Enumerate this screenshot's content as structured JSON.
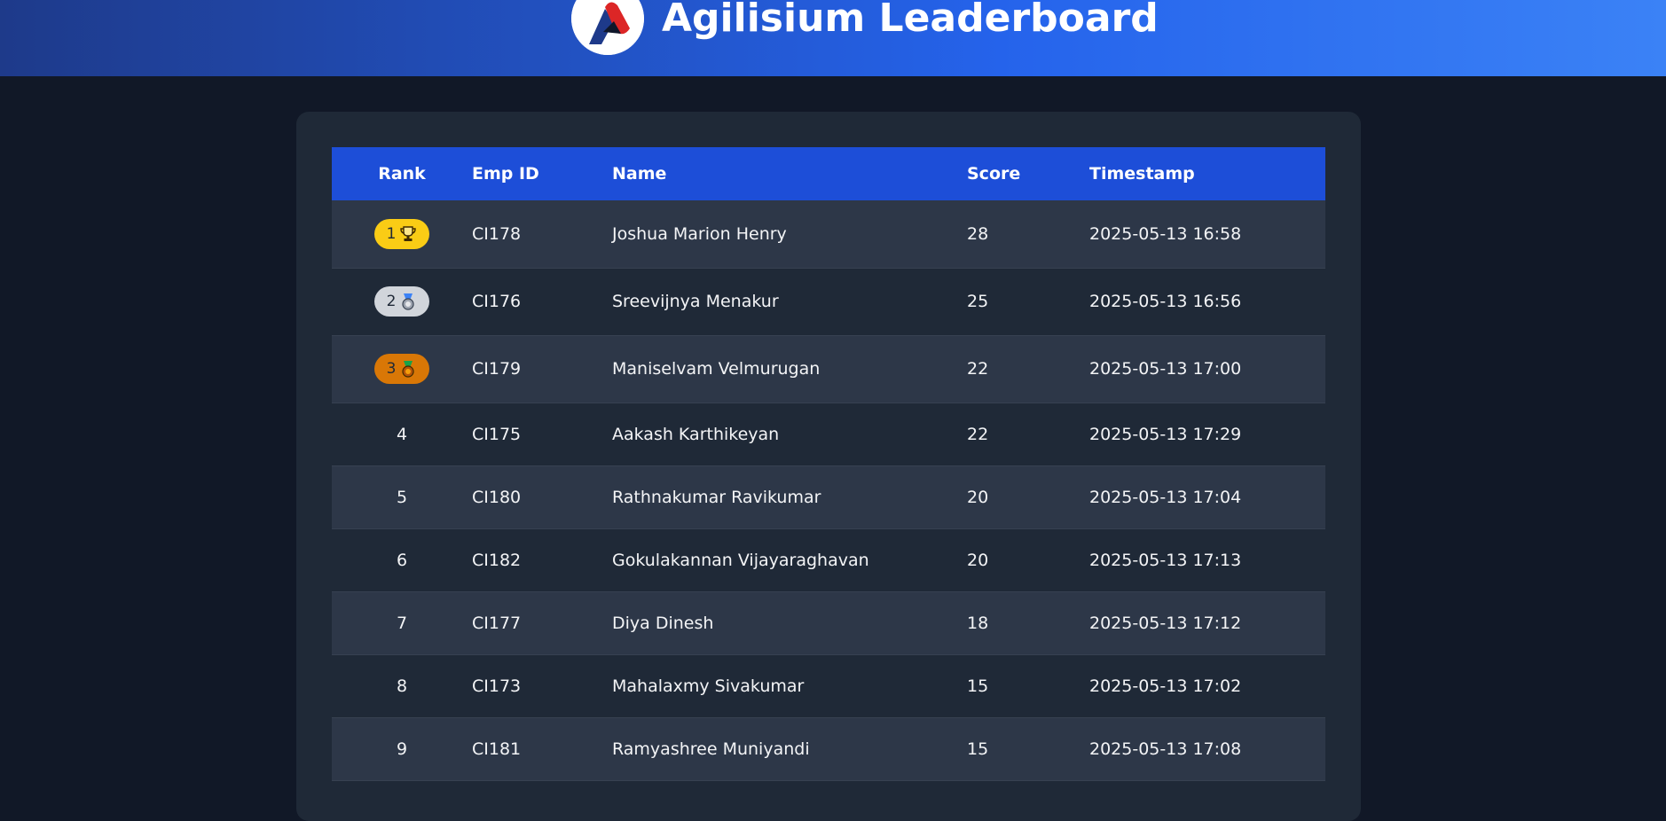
{
  "header": {
    "title": "Agilisium Leaderboard",
    "logo_icon": "agilisium-logo",
    "colors": {
      "gradient_start": "#1e3a8a",
      "gradient_end": "#3b82f6"
    }
  },
  "table": {
    "columns": [
      "Rank",
      "Emp ID",
      "Name",
      "Score",
      "Timestamp"
    ],
    "header_color": "#1d4ed8",
    "rows": [
      {
        "rank": "1",
        "medal": "trophy-icon",
        "badge_color": "#facc15",
        "emp_id": "CI178",
        "name": "Joshua Marion Henry",
        "score": "28",
        "timestamp": "2025-05-13 16:58"
      },
      {
        "rank": "2",
        "medal": "silver-medal-icon",
        "badge_color": "#d1d5db",
        "emp_id": "CI176",
        "name": "Sreevijnya Menakur",
        "score": "25",
        "timestamp": "2025-05-13 16:56"
      },
      {
        "rank": "3",
        "medal": "bronze-medal-icon",
        "badge_color": "#d97706",
        "emp_id": "CI179",
        "name": "Maniselvam Velmurugan",
        "score": "22",
        "timestamp": "2025-05-13 17:00"
      },
      {
        "rank": "4",
        "emp_id": "CI175",
        "name": "Aakash Karthikeyan",
        "score": "22",
        "timestamp": "2025-05-13 17:29"
      },
      {
        "rank": "5",
        "emp_id": "CI180",
        "name": "Rathnakumar Ravikumar",
        "score": "20",
        "timestamp": "2025-05-13 17:04"
      },
      {
        "rank": "6",
        "emp_id": "CI182",
        "name": "Gokulakannan Vijayaraghavan",
        "score": "20",
        "timestamp": "2025-05-13 17:13"
      },
      {
        "rank": "7",
        "emp_id": "CI177",
        "name": "Diya Dinesh",
        "score": "18",
        "timestamp": "2025-05-13 17:12"
      },
      {
        "rank": "8",
        "emp_id": "CI173",
        "name": "Mahalaxmy Sivakumar",
        "score": "15",
        "timestamp": "2025-05-13 17:02"
      },
      {
        "rank": "9",
        "emp_id": "CI181",
        "name": "Ramyashree Muniyandi",
        "score": "15",
        "timestamp": "2025-05-13 17:08"
      }
    ]
  }
}
